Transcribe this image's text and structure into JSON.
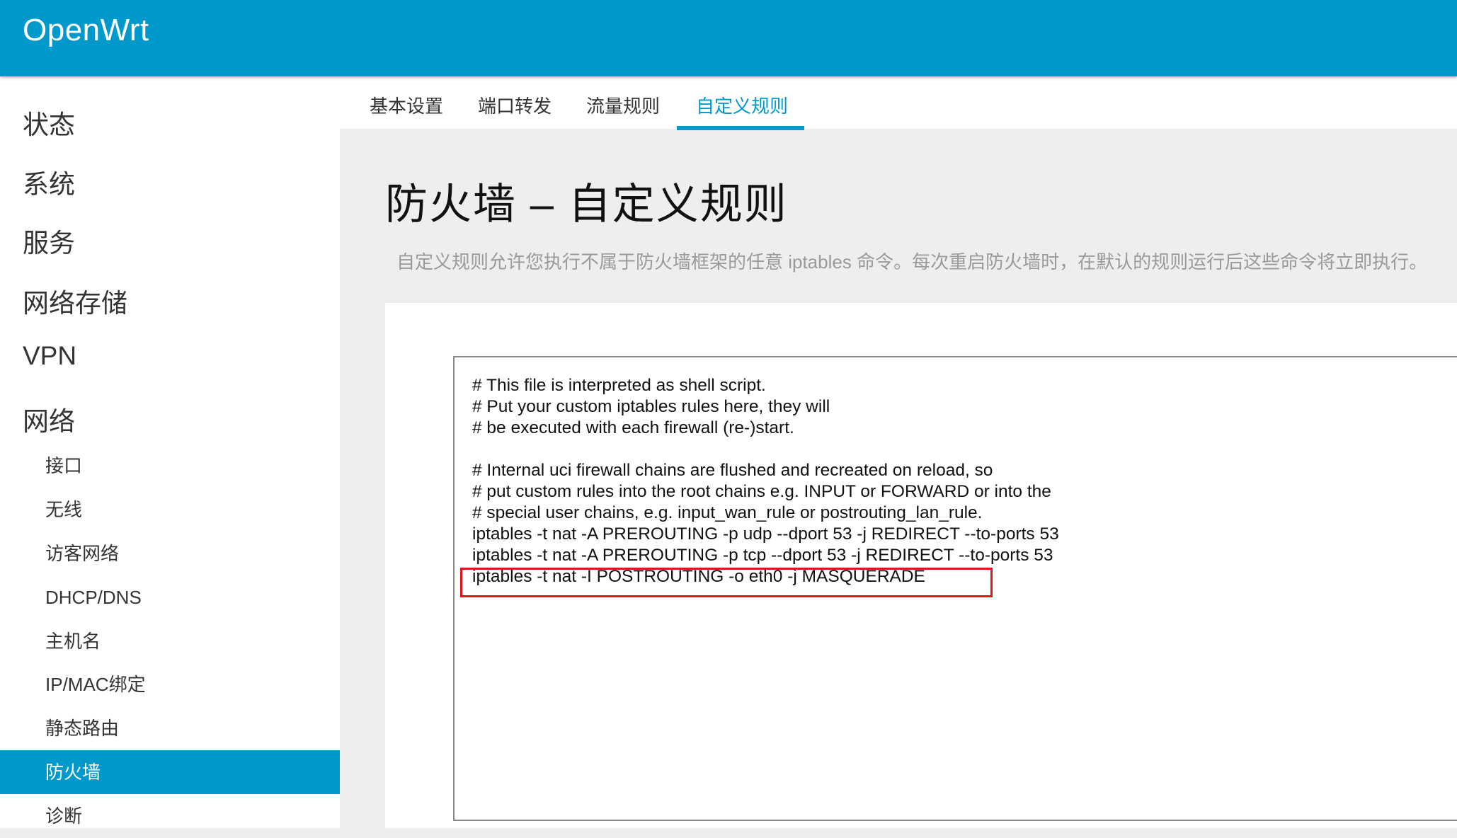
{
  "app": {
    "title": "OpenWrt"
  },
  "sidebar": {
    "top_items": [
      {
        "label": "状态"
      },
      {
        "label": "系统"
      },
      {
        "label": "服务"
      },
      {
        "label": "网络存储"
      },
      {
        "label": "VPN"
      },
      {
        "label": "网络"
      }
    ],
    "sub_items": [
      {
        "label": "接口"
      },
      {
        "label": "无线"
      },
      {
        "label": "访客网络"
      },
      {
        "label": "DHCP/DNS"
      },
      {
        "label": "主机名"
      },
      {
        "label": "IP/MAC绑定"
      },
      {
        "label": "静态路由"
      },
      {
        "label": "防火墙",
        "active": true
      },
      {
        "label": "诊断"
      }
    ]
  },
  "tabs": [
    {
      "label": "基本设置"
    },
    {
      "label": "端口转发"
    },
    {
      "label": "流量规则"
    },
    {
      "label": "自定义规则",
      "active": true
    }
  ],
  "page": {
    "title": "防火墙 – 自定义规则",
    "description": "自定义规则允许您执行不属于防火墙框架的任意 iptables 命令。每次重启防火墙时，在默认的规则运行后这些命令将立即执行。"
  },
  "editor": {
    "lines": [
      "# This file is interpreted as shell script.",
      "# Put your custom iptables rules here, they will",
      "# be executed with each firewall (re-)start.",
      "",
      "# Internal uci firewall chains are flushed and recreated on reload, so",
      "# put custom rules into the root chains e.g. INPUT or FORWARD or into the",
      "# special user chains, e.g. input_wan_rule or postrouting_lan_rule.",
      "iptables -t nat -A PREROUTING -p udp --dport 53 -j REDIRECT --to-ports 53",
      "iptables -t nat -A PREROUTING -p tcp --dport 53 -j REDIRECT --to-ports 53",
      "iptables -t nat -I POSTROUTING -o eth0 -j MASQUERADE"
    ]
  },
  "colors": {
    "accent": "#0099cc",
    "highlight_border": "#e0151b",
    "description_text": "#9a9a9a"
  }
}
